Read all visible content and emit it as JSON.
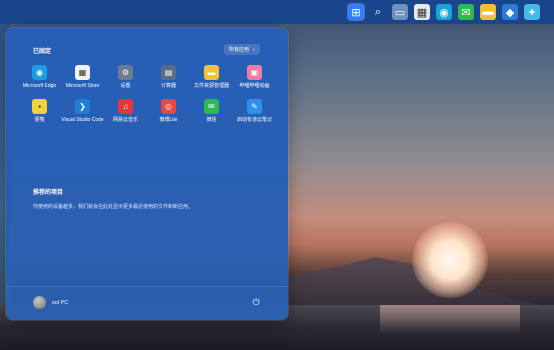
{
  "taskbar": {
    "icons": [
      {
        "name": "windows-start-icon",
        "glyph": "⊞",
        "bg": "#2e80ff"
      },
      {
        "name": "search-icon",
        "glyph": "⌕",
        "bg": "transparent"
      },
      {
        "name": "task-view-icon",
        "glyph": "▭",
        "bg": "#6f8fb8"
      },
      {
        "name": "calendar-icon",
        "glyph": "▦",
        "bg": "#e8e8e8"
      },
      {
        "name": "edge-icon",
        "glyph": "◉",
        "bg": "#17a2d8"
      },
      {
        "name": "wechat-icon",
        "glyph": "✉",
        "bg": "#2dbb4e"
      },
      {
        "name": "folder-icon",
        "glyph": "▬",
        "bg": "#f0c03a"
      },
      {
        "name": "store-icon",
        "glyph": "◆",
        "bg": "#2b7bd6"
      },
      {
        "name": "pin-icon",
        "glyph": "✦",
        "bg": "#49b7f0"
      }
    ]
  },
  "start_menu": {
    "pinned_title": "已固定",
    "all_apps_label": "所有应用",
    "all_apps_chevron": "›",
    "apps": [
      {
        "label": "Microsoft Edge",
        "icon": "edge-icon",
        "glyph": "◉",
        "color": "#1b9ee0"
      },
      {
        "label": "Microsoft Store",
        "icon": "store-icon",
        "glyph": "▦",
        "color": "#f2f2f2"
      },
      {
        "label": "设置",
        "icon": "settings-gear-icon",
        "glyph": "⚙",
        "color": "#6b7c93"
      },
      {
        "label": "计算器",
        "icon": "calculator-icon",
        "glyph": "▤",
        "color": "#5a6d84"
      },
      {
        "label": "文件资源管理器",
        "icon": "file-explorer-icon",
        "glyph": "▬",
        "color": "#f3c23a"
      },
      {
        "label": "哔哩哔哩动画",
        "icon": "bilibili-icon",
        "glyph": "▣",
        "color": "#f07aa2"
      },
      {
        "label": "便笺",
        "icon": "sticky-notes-icon",
        "glyph": "▪",
        "color": "#f4d23c"
      },
      {
        "label": "Visual Studio Code",
        "icon": "vscode-icon",
        "glyph": "❯",
        "color": "#1f7fd1"
      },
      {
        "label": "网易云音乐",
        "icon": "netease-music-icon",
        "glyph": "♫",
        "color": "#e8353c"
      },
      {
        "label": "微博Lite",
        "icon": "weibo-icon",
        "glyph": "◎",
        "color": "#e6473f"
      },
      {
        "label": "微信",
        "icon": "wechat-icon",
        "glyph": "✉",
        "color": "#2dbb4e"
      },
      {
        "label": "启动有道云笔记",
        "icon": "youdao-note-icon",
        "glyph": "✎",
        "color": "#2f8ff0"
      }
    ],
    "recommended_title": "推荐的项目",
    "recommended_desc": "你使用的设备越多，我们就会在此处显示更多最近使用的文件和新应用。",
    "user_name": "sol PC",
    "power_glyph": "⏻"
  }
}
